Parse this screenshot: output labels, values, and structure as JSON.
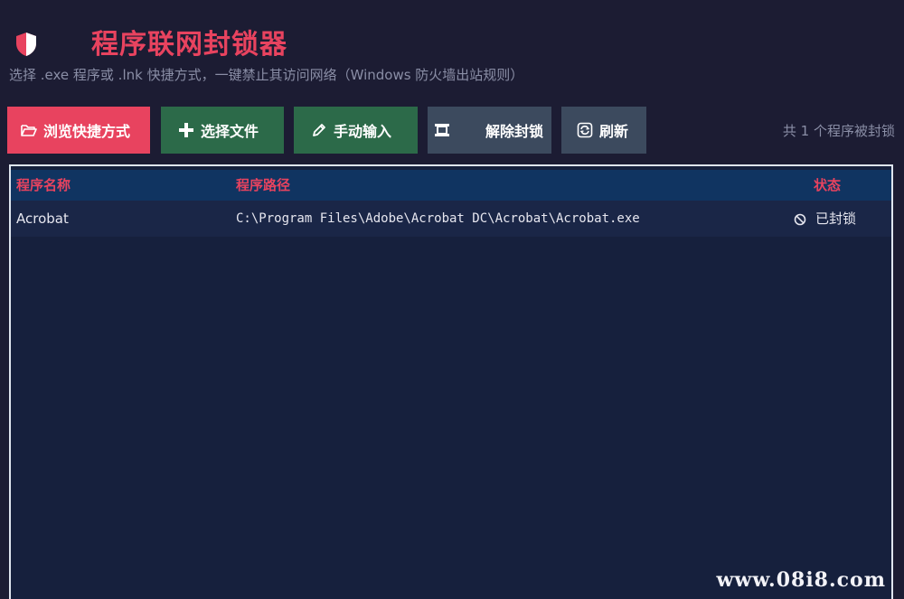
{
  "app": {
    "title": "程序联网封锁器",
    "subtitle": "选择 .exe 程序或 .lnk 快捷方式，一键禁止其访问网络（Windows 防火墙出站规则）",
    "logo_icon": "shield-icon",
    "accent_color": "#e8435f"
  },
  "toolbar": {
    "browse_label": "浏览快捷方式",
    "browse_icon": "folder-open-icon",
    "select_label": "选择文件",
    "select_icon": "plus-icon",
    "manual_label": "手动输入",
    "manual_icon": "pencil-icon",
    "unblock_label": "解除封锁",
    "unblock_icon": "scroll-icon",
    "refresh_label": "刷新",
    "refresh_icon": "refresh-icon"
  },
  "status": {
    "count_label": "共 1 个程序被封锁"
  },
  "table": {
    "headers": {
      "name": "程序名称",
      "path": "程序路径",
      "status": "状态"
    },
    "rows": [
      {
        "name": "Acrobat",
        "path": "C:\\Program Files\\Adobe\\Acrobat DC\\Acrobat\\Acrobat.exe",
        "status": "已封锁",
        "status_icon": "ban-icon"
      }
    ]
  },
  "watermark": "www.08i8.com"
}
